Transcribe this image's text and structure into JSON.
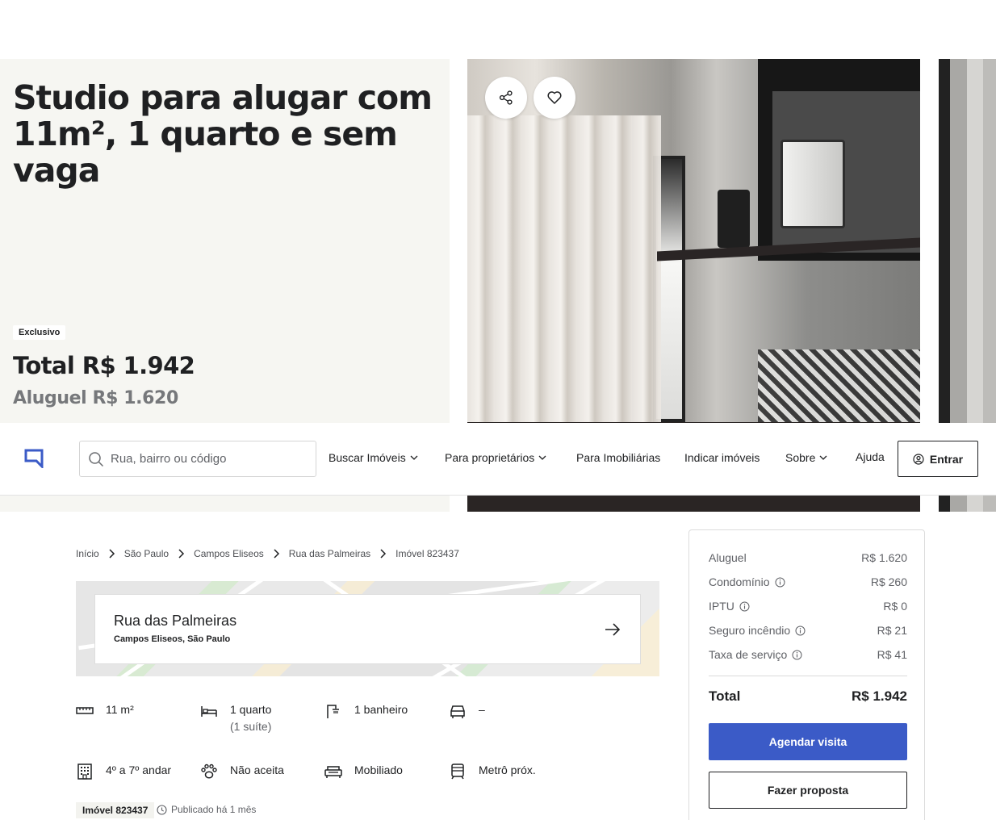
{
  "hero": {
    "title": "Studio para alugar com 11m², 1 quarto e sem vaga",
    "badge": "Exclusivo",
    "total": "Total R$ 1.942",
    "rent": "Aluguel R$ 1.620",
    "share_icon": "share-icon",
    "favorite_icon": "heart-icon"
  },
  "navbar": {
    "logo_icon": "logo-icon",
    "search": {
      "placeholder": "Rua, bairro ou código",
      "value": ""
    },
    "items": [
      {
        "label": "Buscar Imóveis",
        "dropdown": true
      },
      {
        "label": "Para proprietários",
        "dropdown": true
      },
      {
        "label": "Para Imobiliárias",
        "dropdown": false
      },
      {
        "label": "Indicar imóveis",
        "dropdown": false
      },
      {
        "label": "Sobre",
        "dropdown": true
      },
      {
        "label": "Ajuda",
        "dropdown": false
      }
    ],
    "login_label": "Entrar"
  },
  "breadcrumb": [
    "Início",
    "São Paulo",
    "Campos Eliseos",
    "Rua das Palmeiras",
    "Imóvel 823437"
  ],
  "address": {
    "street": "Rua das Palmeiras",
    "area": "Campos Eliseos, São Paulo"
  },
  "features": {
    "area": "11 m²",
    "bedrooms": "1 quarto",
    "suites": "(1 suíte)",
    "bathrooms": "1 banheiro",
    "parking": "–",
    "floor": "4º a 7º andar",
    "pets": "Não aceita",
    "furnished": "Mobiliado",
    "metro": "Metrô próx."
  },
  "listing": {
    "id_tag": "Imóvel 823437",
    "published": "Publicado há 1 mês"
  },
  "price_card": {
    "rows": [
      {
        "label": "Aluguel",
        "value": "R$ 1.620",
        "info": false
      },
      {
        "label": "Condomínio",
        "value": "R$ 260",
        "info": true
      },
      {
        "label": "IPTU",
        "value": "R$ 0",
        "info": true
      },
      {
        "label": "Seguro incêndio",
        "value": "R$ 21",
        "info": true
      },
      {
        "label": "Taxa de serviço",
        "value": "R$ 41",
        "info": true
      }
    ],
    "total_label": "Total",
    "total_value": "R$ 1.942",
    "primary_button": "Agendar visita",
    "secondary_button": "Fazer proposta"
  },
  "colors": {
    "accent": "#3b5bc7",
    "hero_bg": "#f6f6f2",
    "text": "#1f2022",
    "muted": "#76787b"
  }
}
